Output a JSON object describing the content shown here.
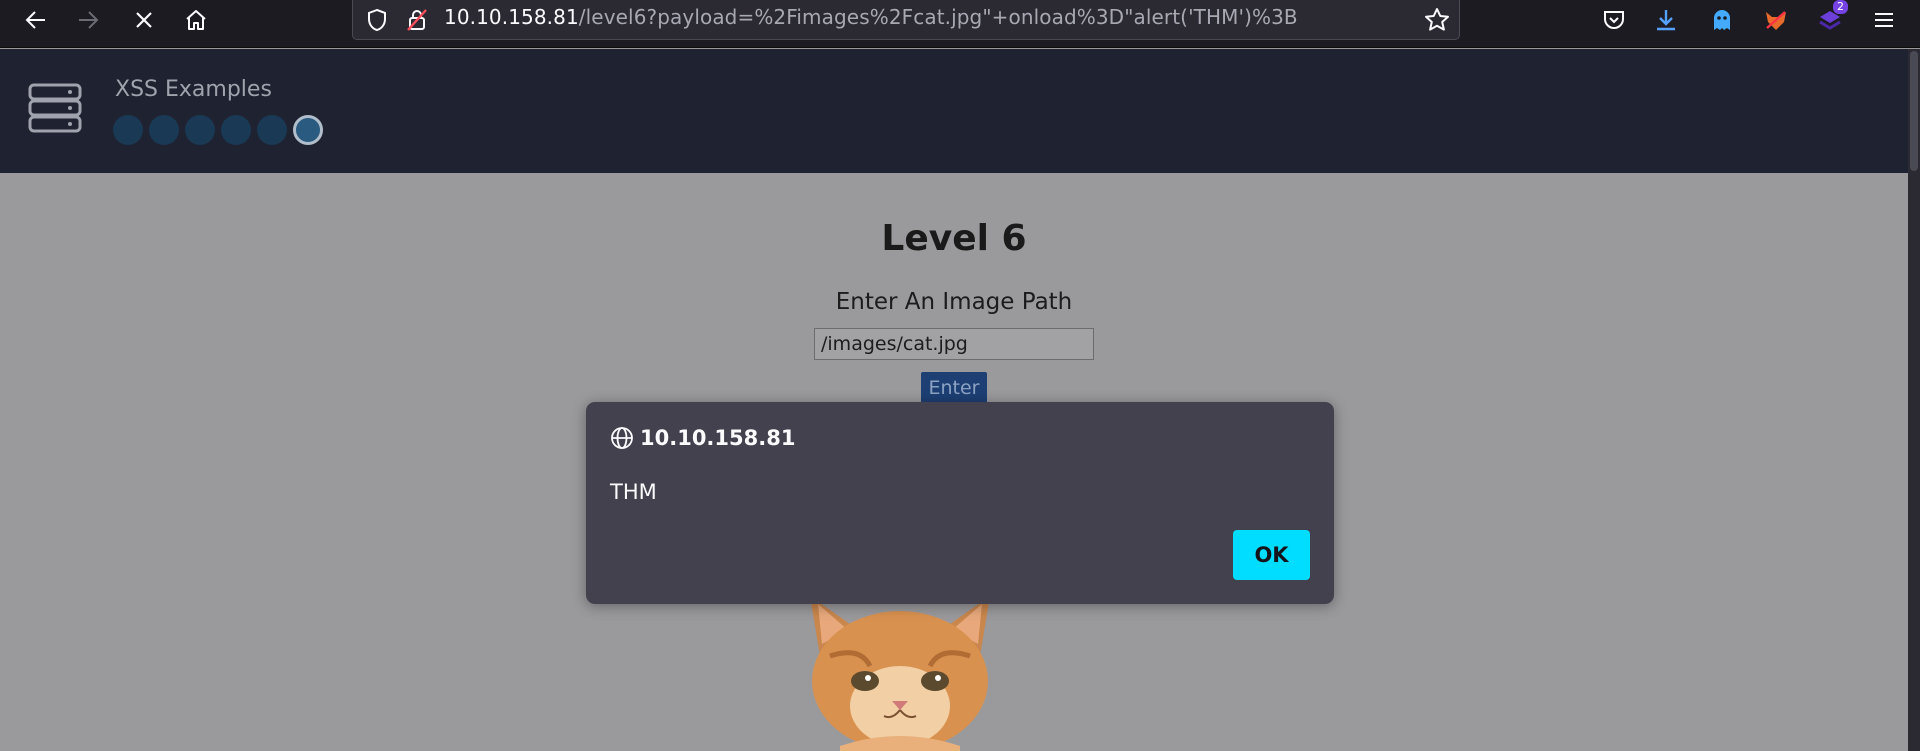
{
  "browser": {
    "url_host": "10.10.158.81",
    "url_path": "/level6?payload=%2Fimages%2Fcat.jpg\"+onload%3D\"alert('THM')%3B",
    "extension_badge": "2"
  },
  "header": {
    "site_title": "XSS Examples",
    "levels_total": 6,
    "current_level": 6
  },
  "main": {
    "level_title": "Level 6",
    "prompt": "Enter An Image Path",
    "input_value": "/images/cat.jpg",
    "enter_label": "Enter"
  },
  "alert": {
    "origin": "10.10.158.81",
    "message": "THM",
    "ok_label": "OK"
  },
  "colors": {
    "alert_bg": "#42414d",
    "ok_button": "#00ddff",
    "header_bg": "#1f2230",
    "page_bg_dimmed": "#9a9a9d"
  }
}
